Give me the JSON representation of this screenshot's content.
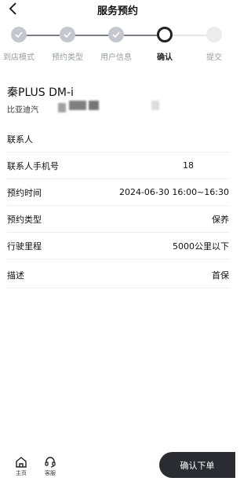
{
  "header": {
    "title": "服务预约"
  },
  "steps": [
    {
      "label": "到店模式",
      "state": "done"
    },
    {
      "label": "预约类型",
      "state": "done"
    },
    {
      "label": "用户信息",
      "state": "done"
    },
    {
      "label": "确认",
      "state": "current"
    },
    {
      "label": "提交",
      "state": "todo"
    }
  ],
  "car": {
    "name": "秦PLUS DM-i",
    "brand": "比亚迪汽"
  },
  "details": [
    {
      "key": "联系人",
      "value": ""
    },
    {
      "key": "联系人手机号",
      "value": "18"
    },
    {
      "key": "预约时间",
      "value": "2024-06-30 16:00~16:30"
    },
    {
      "key": "预约类型",
      "value": "保养"
    },
    {
      "key": "行驶里程",
      "value": "5000公里以下"
    },
    {
      "key": "描述",
      "value": "首保"
    }
  ],
  "bottom_nav": {
    "home_label": "主页",
    "service_label": "客服",
    "confirm_label": "确认下单"
  },
  "colors": {
    "accent_dark": "#2b2c31",
    "step_done": "#c5c7ce",
    "step_todo": "#ececef"
  }
}
